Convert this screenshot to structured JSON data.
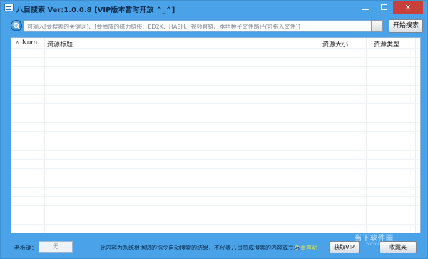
{
  "window": {
    "title": "八目搜索 Ver:1.0.0.8 [VIP版本暂时开放 ^_^]"
  },
  "search": {
    "placeholder": "可输入[要搜索的关键词]、[要播放的磁力链接、ED2K、HASH、视频直链、本地种子文件路径(可拖入文件)]",
    "browse_label": "...",
    "start_label": "开始搜索"
  },
  "table": {
    "columns": [
      {
        "label": "Num."
      },
      {
        "label": "资源标题"
      },
      {
        "label": "资源大小"
      },
      {
        "label": "资源类型"
      }
    ],
    "rows": []
  },
  "status": {
    "boss_key_label": "老板键：",
    "boss_key_value": "无",
    "notice": "此内容为系统根据您的指令自动搜索的结果，不代表八目赞成搜索的内容或立场",
    "disclaimer": "免责声明",
    "vip_label": "获取VIP",
    "fav_label": "收藏夹"
  },
  "watermark": {
    "text": "当下软件园",
    "sub": "www.downxia.com"
  },
  "colors": {
    "frame": "#4aa3e8",
    "close": "#c9403a",
    "disclaimer": "#e8e04a"
  }
}
